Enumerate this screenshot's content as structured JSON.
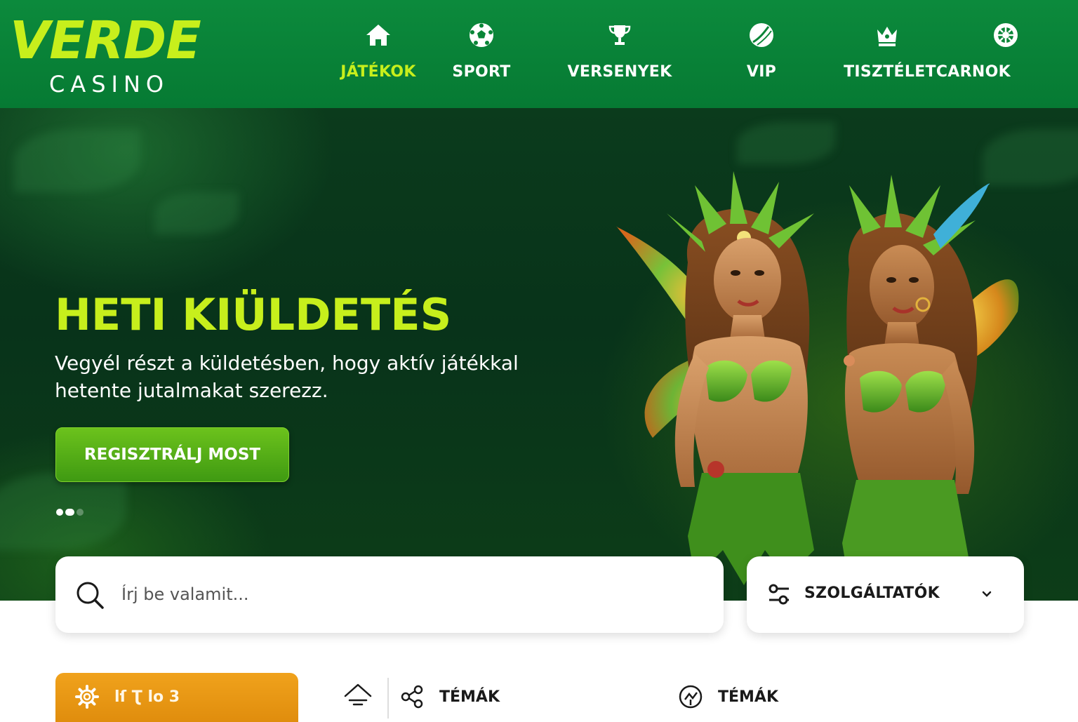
{
  "brand": {
    "logo_main": "VERDE",
    "logo_sub": "CASINO",
    "accent_color": "#c7ef1c",
    "header_color": "#0a8537"
  },
  "nav": {
    "items": [
      {
        "label": "JÁTÉKOK",
        "icon": "home-icon",
        "active": true
      },
      {
        "label": "SPORT",
        "icon": "soccer-ball-icon",
        "active": false
      },
      {
        "label": "VERSENYEK",
        "icon": "trophy-icon",
        "active": false
      },
      {
        "label": "VIP",
        "icon": "tennis-ball-icon",
        "active": false
      },
      {
        "label": "TISZTÉLETCARNOK",
        "icon": "crown-icon",
        "active": false
      },
      {
        "label": "",
        "icon": "roulette-wheel-icon",
        "active": false
      }
    ]
  },
  "hero": {
    "title": "HETI KIÜLDETÉS",
    "text": "Vegyél részt a küldetésben, hogy aktív játékkal hetente jutalmakat szerezz.",
    "cta_label": "REGISZTRÁLJ MOST",
    "slides_total": 3,
    "slide_active": 2,
    "art": "two-forest-fairies-illustration"
  },
  "search": {
    "icon": "search-icon",
    "placeholder": "Írj be valamit..."
  },
  "providers": {
    "icon": "sliders-icon",
    "label": "SZOLGÁLTATÓK",
    "dropdown_icon": "chevron-down-icon"
  },
  "filters": {
    "primary_button": {
      "icon": "gear-icon",
      "label": "lſ Ʈ lo 3",
      "color": "#e8950f"
    },
    "sort_icon": "sort-icon",
    "items": [
      {
        "icon": "share-icon",
        "label": "TÉMÁK"
      },
      {
        "icon": "chart-icon",
        "label": "TÉMÁK"
      }
    ]
  }
}
